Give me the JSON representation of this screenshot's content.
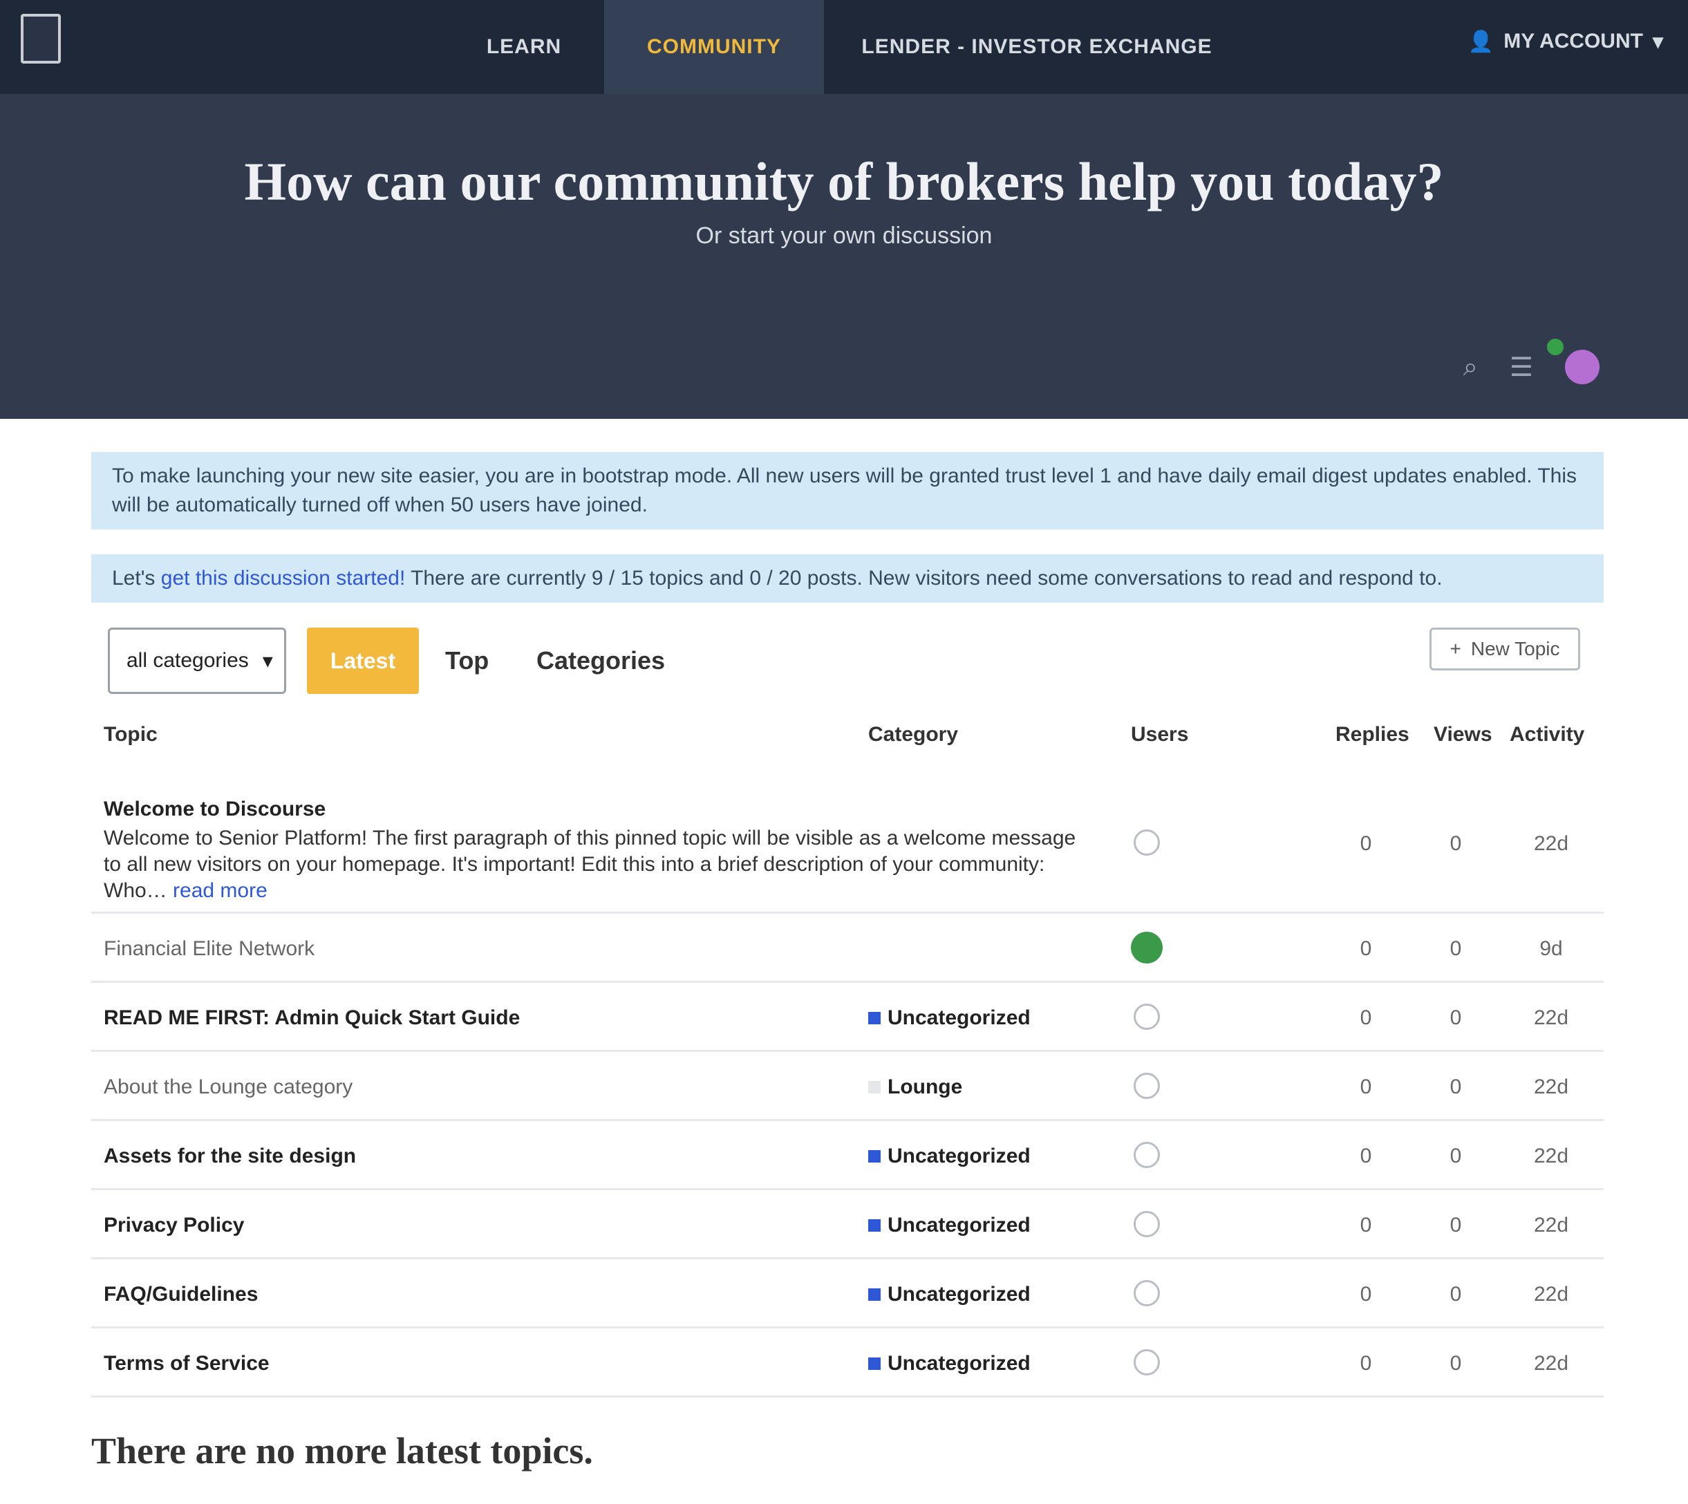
{
  "nav": {
    "logo_text": "",
    "links": [
      "LEARN",
      "COMMUNITY",
      "LENDER - INVESTOR EXCHANGE"
    ],
    "account_label": "MY ACCOUNT",
    "account_caret": "▾",
    "active_link": "COMMUNITY",
    "accent_color": "#f1b93b"
  },
  "hero": {
    "title": "How can our community of brokers help you today?",
    "subtitle": "Or start your own discussion",
    "icons": [
      "search-icon",
      "hamburger-menu-icon",
      "user-avatar"
    ]
  },
  "notices": {
    "bootstrap": "To make launching your new site easier, you are in bootstrap mode. All new users will be granted trust level 1 and have daily email digest updates enabled. This will be automatically turned off when 50 users have joined.",
    "discussion_prefix": "Let's ",
    "discussion_link": "get this discussion started!",
    "discussion_text": " There are currently 9 / 15 topics and 0 / 20 posts. New visitors need some conversations to read and respond to."
  },
  "controls": {
    "category_select": "all categories",
    "select_caret": "▾",
    "tabs": [
      "Latest",
      "Top",
      "Categories"
    ],
    "new_topic": "New Topic",
    "new_topic_icon": "+"
  },
  "table": {
    "headers": {
      "topic": "Topic",
      "category": "Category",
      "users": "Users",
      "replies": "Replies",
      "views": "Views",
      "activity": "Activity"
    },
    "rows": [
      {
        "title": "Welcome to Discourse",
        "pinned": true,
        "excerpt": "Welcome to Senior Platform! The first paragraph of this pinned topic will be visible as a welcome message to all new visitors on your homepage. It's important! Edit this into a brief description of your community: Who…",
        "excerpt_link": "read more",
        "category": "",
        "replies": "0",
        "views": "0",
        "activity": "22d",
        "user_icon": "user-outline"
      },
      {
        "title": "Financial Elite Network",
        "category": "",
        "replies": "0",
        "views": "0",
        "activity": "9d",
        "user_icon": "user-green"
      },
      {
        "title": "READ ME FIRST: Admin Quick Start Guide",
        "category": "Uncategorized",
        "replies": "0",
        "views": "0",
        "activity": "22d",
        "user_icon": "user-outline"
      },
      {
        "title": "About the Lounge category",
        "category": "Lounge",
        "replies": "0",
        "views": "0",
        "activity": "22d",
        "user_icon": "user-outline"
      },
      {
        "title": "Assets for the site design",
        "category": "Uncategorized",
        "replies": "0",
        "views": "0",
        "activity": "22d",
        "user_icon": "user-outline"
      },
      {
        "title": "Privacy Policy",
        "category": "Uncategorized",
        "replies": "0",
        "views": "0",
        "activity": "22d",
        "user_icon": "user-outline"
      },
      {
        "title": "FAQ/Guidelines",
        "category": "Uncategorized",
        "replies": "0",
        "views": "0",
        "activity": "22d",
        "user_icon": "user-outline"
      },
      {
        "title": "Terms of Service",
        "category": "Uncategorized",
        "replies": "0",
        "views": "0",
        "activity": "22d",
        "user_icon": "user-outline"
      }
    ]
  },
  "footer": {
    "message": "There are no more latest topics."
  }
}
